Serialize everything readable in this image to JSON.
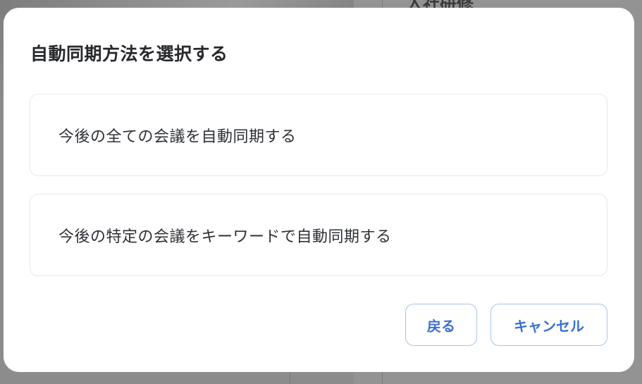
{
  "background": {
    "title": "入社研修"
  },
  "dialog": {
    "title": "自動同期方法を選択する",
    "options": [
      {
        "label": "今後の全ての会議を自動同期する"
      },
      {
        "label": "今後の特定の会議をキーワードで自動同期する"
      }
    ],
    "buttons": {
      "back_label": "戻る",
      "cancel_label": "キャンセル"
    }
  },
  "colors": {
    "accent": "#3b6fd1",
    "button_border": "#a9c4ec",
    "card_border": "#e6e7ea",
    "overlay": "#8a8a8a"
  }
}
